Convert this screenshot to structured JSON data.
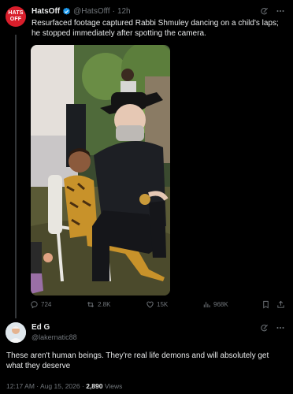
{
  "post": {
    "author": "HatsOff",
    "handle": "@HatsOfff",
    "separator": "·",
    "time": "12h",
    "avatar_text": "HATS OFF",
    "text": "Resurfaced footage captured Rabbi Shmuley dancing on a child's laps; he stopped immediately after spotting the camera.",
    "stats": {
      "replies": "724",
      "reposts": "2.8K",
      "likes": "15K",
      "views": "968K"
    }
  },
  "reply": {
    "author": "Ed G",
    "handle": "@lakernatic88",
    "text": "These aren't human beings. They're real life demons and will absolutely get what they deserve",
    "time": "12:17 AM",
    "date": "Aug 15, 2026",
    "views_count": "2,890",
    "views_label": "Views"
  },
  "colors": {
    "background": "#000000",
    "text": "#e7e9ea",
    "muted": "#71767b",
    "verified": "#1d9bf0",
    "avatar_hatsoff": "#d81e2b"
  },
  "icons": [
    "verified-badge-icon",
    "grok-icon",
    "more-icon",
    "reply-icon",
    "repost-icon",
    "like-icon",
    "views-icon",
    "bookmark-icon",
    "share-icon"
  ]
}
